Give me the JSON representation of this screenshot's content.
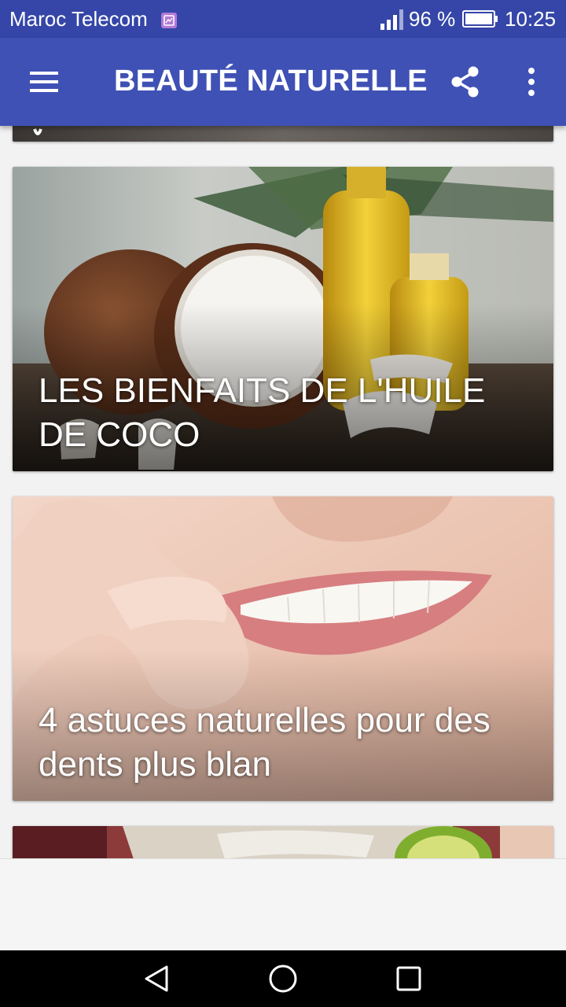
{
  "status_bar": {
    "carrier": "Maroc Telecom",
    "battery_percent": "96 %",
    "time": "10:25",
    "icons": [
      "sim-icon",
      "signal-icon",
      "battery-icon"
    ]
  },
  "toolbar": {
    "title": "BEAUTÉ NATURELLE",
    "icons": [
      "menu-icon",
      "share-icon",
      "more-vert-icon"
    ]
  },
  "articles": [
    {
      "title": "LES BIENFAITS DE L'HUILE DE COCO",
      "image": "coconut-oil-photo"
    },
    {
      "title": "4 astuces naturelles pour des dents plus blan",
      "image": "white-teeth-smile-photo"
    }
  ],
  "nav_bar": {
    "icons": [
      "back-icon",
      "home-icon",
      "recents-icon"
    ]
  },
  "colors": {
    "primary": "#3f51b5",
    "status_bar": "#3546a8",
    "background": "#f2f2f2"
  }
}
